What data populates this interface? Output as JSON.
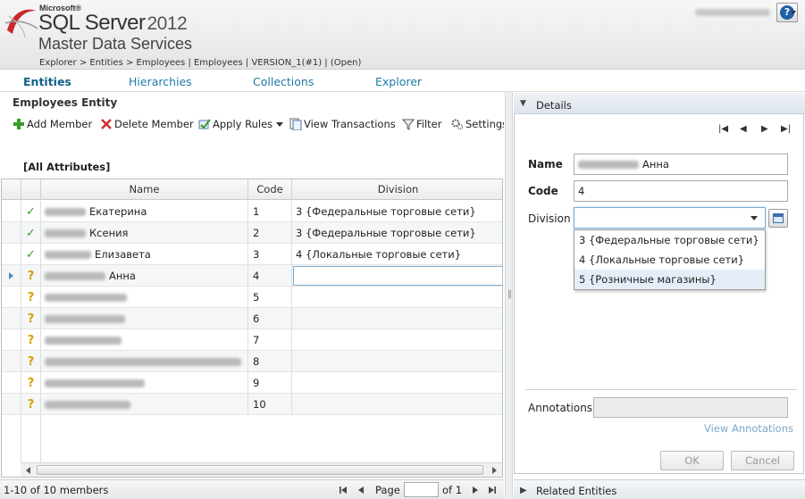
{
  "header": {
    "brand_small": "Microsoft®",
    "product": "SQL Server",
    "version": "2012",
    "subproduct": "Master Data Services",
    "breadcrumb": "Explorer > Entities > Employees | Employees | VERSION_1(#1) | (Open)",
    "help_label": "?"
  },
  "nav": {
    "tabs": [
      {
        "label": "Entities",
        "active": true
      },
      {
        "label": "Hierarchies",
        "active": false
      },
      {
        "label": "Collections",
        "active": false
      },
      {
        "label": "Explorer",
        "active": false
      }
    ]
  },
  "entity_title": "Employees Entity",
  "toolbar": {
    "add_member": "Add Member",
    "delete_member": "Delete Member",
    "apply_rules": "Apply Rules",
    "view_transactions": "View Transactions",
    "filter": "Filter",
    "settings": "Settings"
  },
  "attributes_label": "[All Attributes]",
  "grid": {
    "columns": [
      "Name",
      "Code",
      "Division"
    ],
    "rows": [
      {
        "status": "valid",
        "name": "Екатерина",
        "code": "1",
        "division": "3 {Федеральные торговые сети}"
      },
      {
        "status": "valid",
        "name": "Ксения",
        "code": "2",
        "division": "3 {Федеральные торговые сети}"
      },
      {
        "status": "valid",
        "name": "Елизавета",
        "code": "3",
        "division": "4 {Локальные торговые сети}"
      },
      {
        "status": "pending",
        "name": "Анна",
        "code": "4",
        "division": "",
        "selected": true
      },
      {
        "status": "pending",
        "name": "",
        "code": "5",
        "division": ""
      },
      {
        "status": "pending",
        "name": "",
        "code": "6",
        "division": ""
      },
      {
        "status": "pending",
        "name": "",
        "code": "7",
        "division": ""
      },
      {
        "status": "pending",
        "name": "",
        "code": "8",
        "division": ""
      },
      {
        "status": "pending",
        "name": "",
        "code": "9",
        "division": ""
      },
      {
        "status": "pending",
        "name": "",
        "code": "10",
        "division": ""
      }
    ]
  },
  "status_bar": {
    "count": "1-10 of 10 members",
    "page_label": "Page",
    "page_value": "",
    "of_label": "of 1"
  },
  "details": {
    "title": "Details",
    "name_label": "Name",
    "name_value": "Анна",
    "code_label": "Code",
    "code_value": "4",
    "division_label": "Division",
    "division_value": "",
    "division_options": [
      "3 {Федеральные торговые сети}",
      "4 {Локальные торговые сети}",
      "5 {Розничные магазины}"
    ],
    "annotations_label": "Annotations",
    "view_annotations": "View Annotations",
    "ok": "OK",
    "cancel": "Cancel"
  },
  "related_entities": "Related Entities",
  "colors": {
    "link": "#1f7aa8",
    "valid": "#3a9a2a",
    "pending": "#d4a000"
  }
}
